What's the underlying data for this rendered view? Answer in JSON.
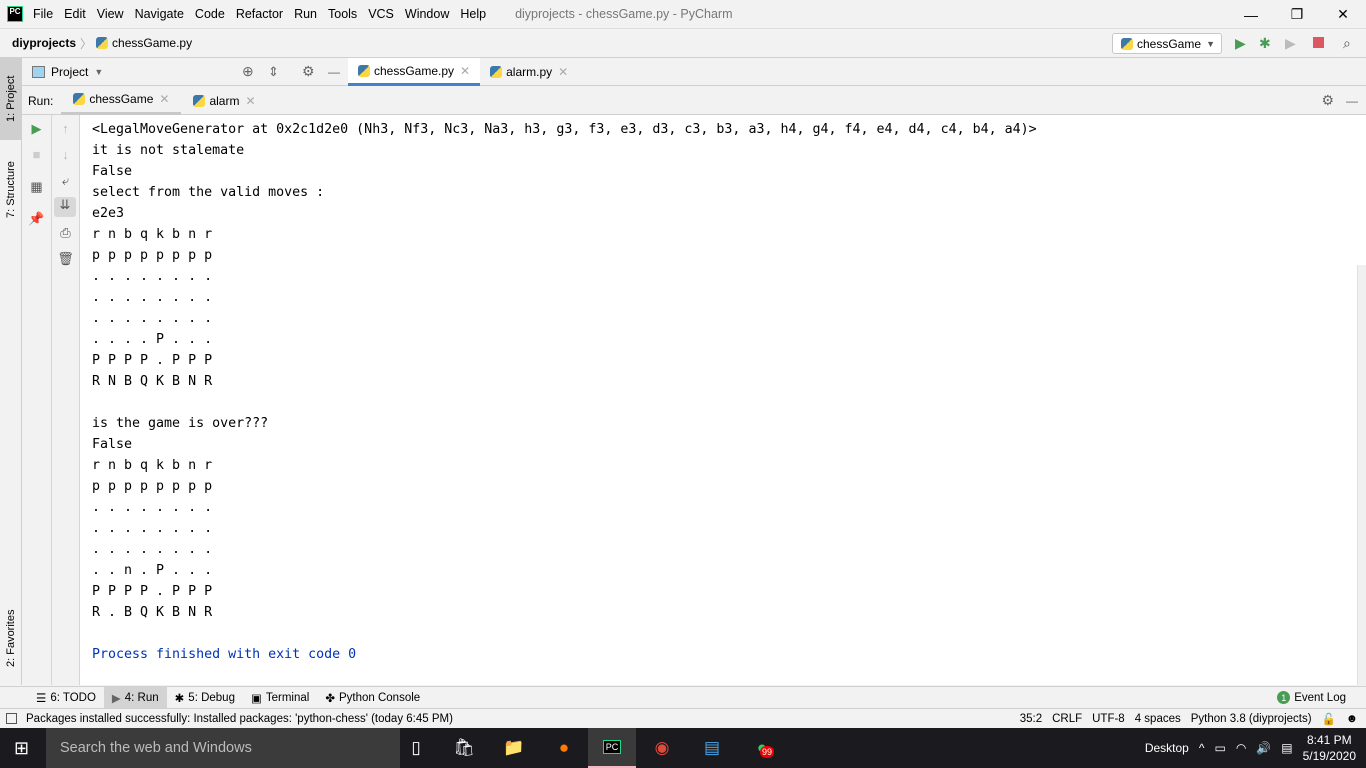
{
  "titlebar": {
    "menu": [
      "File",
      "Edit",
      "View",
      "Navigate",
      "Code",
      "Refactor",
      "Run",
      "Tools",
      "VCS",
      "Window",
      "Help"
    ],
    "title": "diyprojects - chessGame.py - PyCharm",
    "logo": "PC"
  },
  "navbar": {
    "project": "diyprojects",
    "file": "chessGame.py",
    "run_config": "chessGame"
  },
  "left_strip": {
    "project_tab": "1: Project",
    "structure_tab": "7: Structure",
    "favorites_tab": "2: Favorites"
  },
  "project_pane": {
    "label": "Project"
  },
  "editor_tabs": [
    {
      "label": "chessGame.py",
      "active": true
    },
    {
      "label": "alarm.py",
      "active": false
    }
  ],
  "run": {
    "label": "Run:",
    "tabs": [
      {
        "label": "chessGame",
        "active": true
      },
      {
        "label": "alarm",
        "active": false
      }
    ]
  },
  "console": {
    "lines": [
      "<LegalMoveGenerator at 0x2c1d2e0 (Nh3, Nf3, Nc3, Na3, h3, g3, f3, e3, d3, c3, b3, a3, h4, g4, f4, e4, d4, c4, b4, a4)>",
      "it is not stalemate",
      "False",
      "select from the valid moves :",
      "e2e3",
      "r n b q k b n r",
      "p p p p p p p p",
      ". . . . . . . .",
      ". . . . . . . .",
      ". . . . . . . .",
      ". . . . P . . .",
      "P P P P . P P P",
      "R N B Q K B N R",
      "",
      "is the game is over???",
      "False",
      "r n b q k b n r",
      "p p p p p p p p",
      ". . . . . . . .",
      ". . . . . . . .",
      ". . . . . . . .",
      ". . n . P . . .",
      "P P P P . P P P",
      "R . B Q K B N R",
      ""
    ],
    "finished": "Process finished with exit code 0"
  },
  "bottom_tools": [
    {
      "label": "6: TODO"
    },
    {
      "label": "4: Run",
      "active": true
    },
    {
      "label": "5: Debug"
    },
    {
      "label": "Terminal"
    },
    {
      "label": "Python Console"
    }
  ],
  "event_log": {
    "label": "Event Log",
    "count": "1"
  },
  "status": {
    "message": "Packages installed successfully: Installed packages: 'python-chess' (today 6:45 PM)",
    "position": "35:2",
    "line_sep": "CRLF",
    "encoding": "UTF-8",
    "indent": "4 spaces",
    "interpreter": "Python 3.8 (diyprojects)"
  },
  "taskbar": {
    "search": "Search the web and Windows",
    "desktop": "Desktop",
    "time": "8:41 PM",
    "date": "5/19/2020",
    "whatsapp_badge": "99"
  },
  "colors": {
    "accent": "#4083c9",
    "run_green": "#499c54",
    "stop_red": "#db5860",
    "console_blue": "#0033b3"
  }
}
